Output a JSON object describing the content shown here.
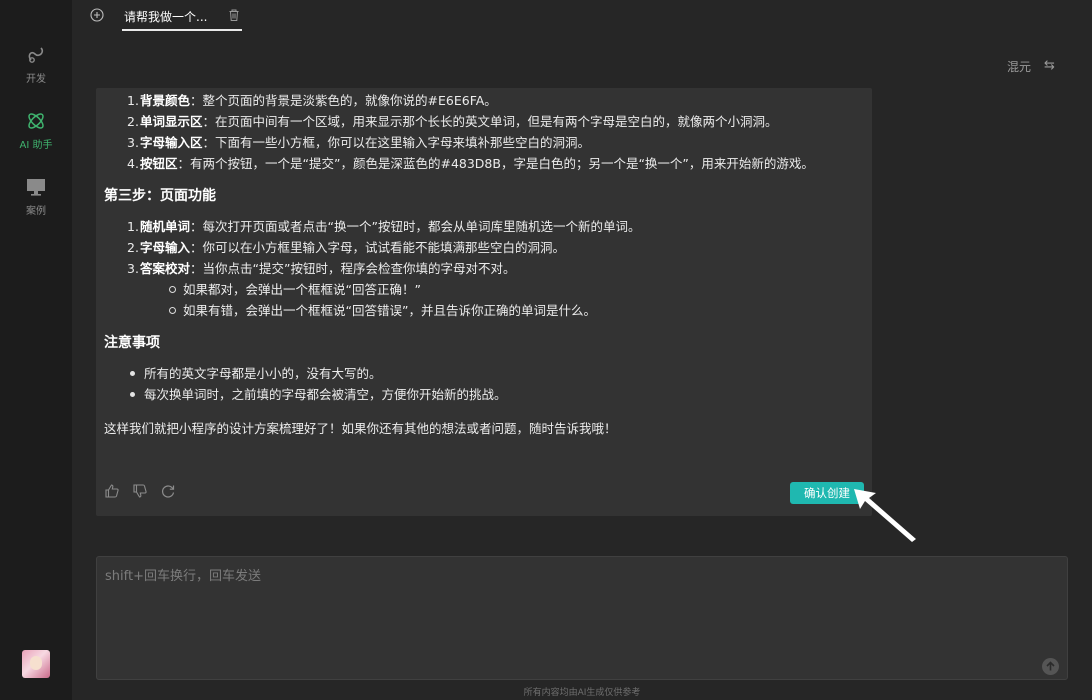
{
  "sidebar": {
    "items": [
      {
        "label": "开发",
        "icon": "link-icon"
      },
      {
        "label": "AI 助手",
        "icon": "atom-icon",
        "active": true
      },
      {
        "label": "案例",
        "icon": "monitor-icon"
      }
    ]
  },
  "tabs": [
    {
      "label": "请帮我做一个..."
    }
  ],
  "header": {
    "model": "混元"
  },
  "message": {
    "list1": [
      {
        "num": "1.",
        "title": "背景颜色",
        "text": "：整个页面的背景是淡紫色的，就像你说的#E6E6FA。"
      },
      {
        "num": "2.",
        "title": "单词显示区",
        "text": "：在页面中间有一个区域，用来显示那个长长的英文单词，但是有两个字母是空白的，就像两个小洞洞。"
      },
      {
        "num": "3.",
        "title": "字母输入区",
        "text": "：下面有一些小方框，你可以在这里输入字母来填补那些空白的洞洞。"
      },
      {
        "num": "4.",
        "title": "按钮区",
        "text": "：有两个按钮，一个是“提交”，颜色是深蓝色的#483D8B，字是白色的；另一个是“换一个”，用来开始新的游戏。"
      }
    ],
    "heading_step3": "第三步：页面功能",
    "list2": [
      {
        "num": "1.",
        "title": "随机单词",
        "text": "：每次打开页面或者点击“换一个”按钮时，都会从单词库里随机选一个新的单词。"
      },
      {
        "num": "2.",
        "title": "字母输入",
        "text": "：你可以在小方框里输入字母，试试看能不能填满那些空白的洞洞。"
      },
      {
        "num": "3.",
        "title": "答案校对",
        "text": "：当你点击“提交”按钮时，程序会检查你填的字母对不对。"
      }
    ],
    "sublist": [
      "如果都对，会弹出一个框框说“回答正确！”",
      "如果有错，会弹出一个框框说“回答错误”，并且告诉你正确的单词是什么。"
    ],
    "heading_notes": "注意事项",
    "notes": [
      "所有的英文字母都是小小的，没有大写的。",
      "每次换单词时，之前填的字母都会被清空，方便你开始新的挑战。"
    ],
    "closing": "这样我们就把小程序的设计方案梳理好了！如果你还有其他的想法或者问题，随时告诉我哦！",
    "confirm_button": "确认创建"
  },
  "input": {
    "placeholder": "shift+回车换行，回车发送",
    "value": ""
  },
  "footer": {
    "note": "所有内容均由AI生成仅供参考"
  },
  "colors": {
    "accent": "#1fb8b0",
    "active_nav": "#3fb36e"
  }
}
